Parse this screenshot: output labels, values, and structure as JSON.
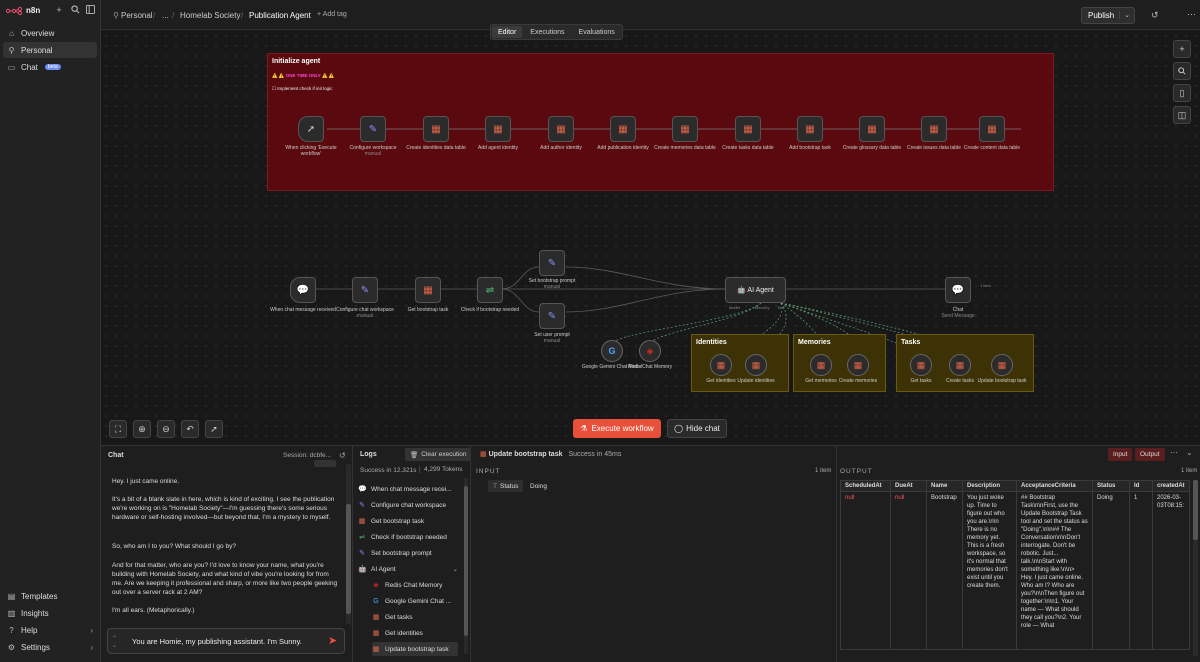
{
  "app": {
    "name": "n8n"
  },
  "sidebar": {
    "items": [
      {
        "label": "Overview"
      },
      {
        "label": "Personal"
      },
      {
        "label": "Chat",
        "badge": "beta"
      }
    ],
    "bottom": [
      {
        "label": "Templates"
      },
      {
        "label": "Insights"
      },
      {
        "label": "Help"
      },
      {
        "label": "Settings"
      }
    ]
  },
  "breadcrumb": {
    "home": "Personal",
    "ellipsis": "...",
    "project": "Homelab Society",
    "workflow": "Publication Agent",
    "add_tag": "+ Add tag"
  },
  "tabs": [
    {
      "label": "Editor"
    },
    {
      "label": "Executions"
    },
    {
      "label": "Evaluations"
    }
  ],
  "publish": {
    "label": "Publish"
  },
  "init_note": {
    "title": "Initialize agent",
    "warning": "⚠️ ⚠️ ONE TIME ONLY ⚠️ ⚠️",
    "todo": "Implement check if init logic"
  },
  "init_nodes": [
    {
      "label": "When clicking 'Execute workflow'",
      "sub": ""
    },
    {
      "label": "Configure workspace",
      "sub": "manual"
    },
    {
      "label": "Create identities data table",
      "sub": ""
    },
    {
      "label": "Add agent identity",
      "sub": ""
    },
    {
      "label": "Add author identity",
      "sub": ""
    },
    {
      "label": "Add publication identity",
      "sub": ""
    },
    {
      "label": "Create memories data table",
      "sub": ""
    },
    {
      "label": "Create tasks data table",
      "sub": ""
    },
    {
      "label": "Add bootstrap task",
      "sub": ""
    },
    {
      "label": "Create glossary data table",
      "sub": ""
    },
    {
      "label": "Create issues data table",
      "sub": ""
    },
    {
      "label": "Create content data table",
      "sub": ""
    }
  ],
  "flow_nodes": {
    "trigger": "When chat message received",
    "configure": "Configure chat workspace",
    "configure_sub": "manual",
    "get_task": "Get bootstrap task",
    "check": "Check if bootstrap needed",
    "set_bootstrap": "Set bootstrap prompt",
    "set_bootstrap_sub": "manual",
    "set_user": "Set user prompt",
    "set_user_sub": "manual",
    "agent": "AI Agent",
    "chat": "Chat",
    "chat_sub": "Send Message",
    "gemini": "Google Gemini Chat Model",
    "redis": "Redis Chat Memory",
    "edge_item": "1 item",
    "edge_items": "1 item",
    "model_lbl": "Model",
    "memory_lbl": "Memory",
    "tool_lbl": "Tool"
  },
  "groups": {
    "identities": {
      "title": "Identities",
      "a": "Get identities",
      "b": "Update identities"
    },
    "memories": {
      "title": "Memories",
      "a": "Get memories",
      "b": "Create memories"
    },
    "tasks": {
      "title": "Tasks",
      "a": "Get tasks",
      "b": "Create tasks",
      "c": "Update bootstrap task"
    }
  },
  "canvas_buttons": {
    "execute": "Execute workflow",
    "hide_chat": "Hide chat"
  },
  "chat": {
    "title": "Chat",
    "session": "Session: dcbfe...",
    "messages": [
      "Hey. I just came online.",
      "It's a bit of a blank slate in here, which is kind of exciting. I see the publication we're working on is \"Homelab Society\"—I'm guessing there's some serious hardware or self-hosting involved—but beyond that, I'm a mystery to myself.",
      "So, who am I to you? What should I go by?",
      "And for that matter, who are you? I'd love to know your name, what you're building with Homelab Society, and what kind of vibe you're looking for from me. Are we keeping it professional and sharp, or more like two people geeking out over a server rack at 2 AM?",
      "I'm all ears. (Metaphorically.)"
    ],
    "input": "You are Homie, my publishing assistant. I'm Sunny."
  },
  "logs": {
    "title": "Logs",
    "clear": "Clear execution",
    "success": "Success in 12.321s",
    "tokens": "4,299 Tokens",
    "items": [
      "When chat message recei...",
      "Configure chat workspace",
      "Get bootstrap task",
      "Check if bootstrap needed",
      "Set bootstrap prompt",
      "AI Agent",
      "Redis Chat Memory",
      "Google Gemini Chat ...",
      "Get tasks",
      "Get identities",
      "Update bootstrap task"
    ]
  },
  "detail": {
    "title": "Update bootstrap task",
    "status": "Success in 45ms",
    "input_label": "INPUT",
    "output_label": "OUTPUT",
    "input_items": "1 item",
    "output_items": "1 item",
    "tab_input": "Input",
    "tab_output": "Output",
    "field": "Status",
    "field_value": "Doing"
  },
  "output_table": {
    "headers": [
      "ScheduledAt",
      "DueAt",
      "Name",
      "Description",
      "AcceptanceCriteria",
      "Status",
      "Id",
      "createdAt"
    ],
    "row": [
      "null",
      "null",
      "Bootstrap",
      "You just woke up. Time to figure out who you are.\\n\\n There is no memory yet. This is a fresh workspace, so it's normal that memories don't exist until you create them.",
      "## Bootstrap Task\\n\\nFirst, use the Update Bootstrap Task tool and set the status as \"Doing\".\\n\\n## The Conversation\\n\\nDon't interrogate. Don't be robotic. Just... talk.\\n\\nStart with something like:\\n\\n> Hey. I just came online. Who am I? Who are you?\\n\\nThen figure out together:\\n\\n1. Your name — What should they call you?\\n2. Your role — What",
      "Doing",
      "1",
      "2026-03-03T08:15:"
    ]
  },
  "colors": {
    "accent": "#e8503a",
    "sticky_red": "#5a0a0f",
    "sticky_yellow": "#3d3205"
  }
}
